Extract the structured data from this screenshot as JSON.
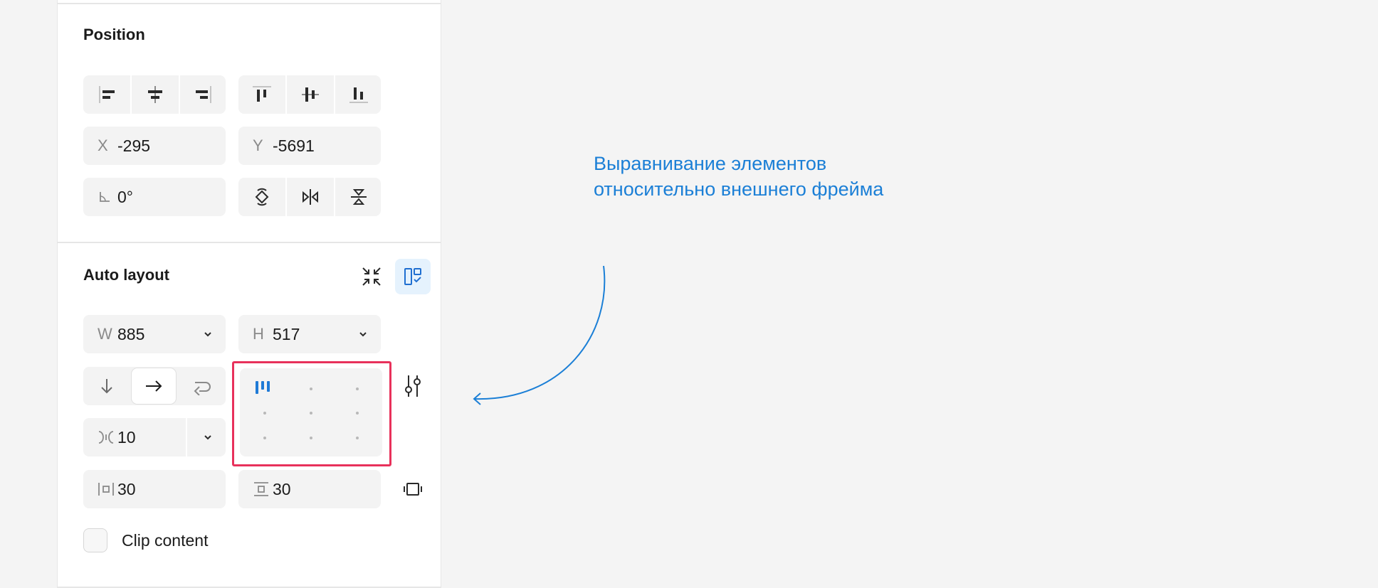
{
  "position": {
    "title": "Position",
    "align_h": [
      "align-left-icon",
      "align-horizontal-center-icon",
      "align-right-icon"
    ],
    "align_v": [
      "align-top-icon",
      "align-vertical-center-icon",
      "align-bottom-icon"
    ],
    "x": {
      "label": "X",
      "value": "-295"
    },
    "y": {
      "label": "Y",
      "value": "-5691"
    },
    "rotation": {
      "icon": "angle-icon",
      "value": "0°"
    },
    "transform_icons": [
      "rotate-90-icon",
      "flip-horizontal-icon",
      "flip-vertical-icon"
    ]
  },
  "auto_layout": {
    "title": "Auto layout",
    "header_icons": [
      "collapse-icon",
      "suggest-layout-icon"
    ],
    "width": {
      "label": "W",
      "value": "885"
    },
    "height": {
      "label": "H",
      "value": "517"
    },
    "direction": {
      "options": [
        "vertical-arrow-icon",
        "horizontal-arrow-icon",
        "wrap-icon"
      ],
      "selected": "horizontal"
    },
    "alignment": {
      "selected": "top-left"
    },
    "gap": {
      "value": "10"
    },
    "padding_horizontal": {
      "value": "30"
    },
    "padding_vertical": {
      "value": "30"
    },
    "clip_content": {
      "label": "Clip content",
      "checked": false
    }
  },
  "annotation": {
    "text": "Выравнивание элементов относительно внешнего фрейма",
    "color": "#1b7fd6",
    "highlight_color": "#e8315b"
  }
}
